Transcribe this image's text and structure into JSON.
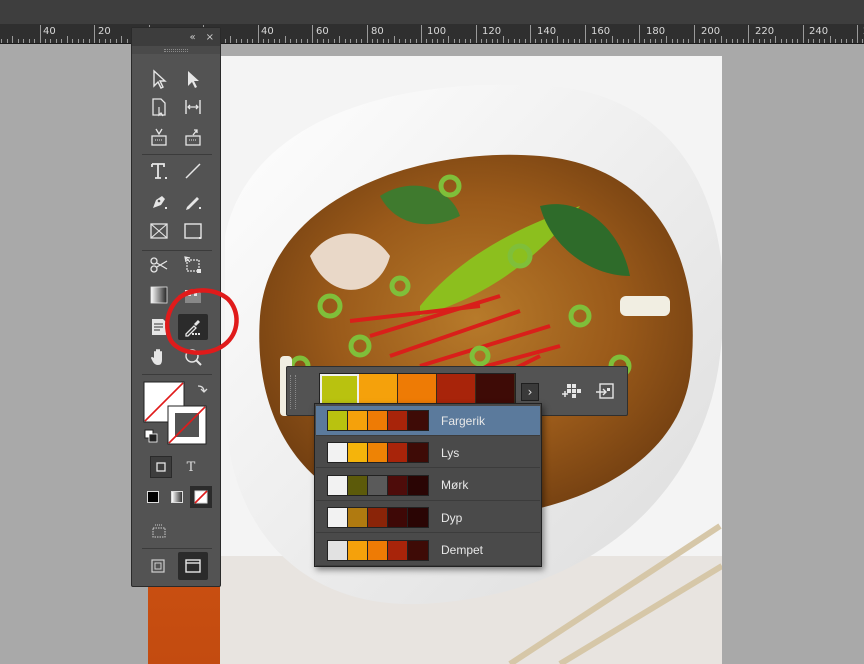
{
  "ruler": {
    "labels": [
      "40",
      "20",
      "",
      "20",
      "40",
      "60",
      "80",
      "100",
      "120",
      "140",
      "160",
      "180",
      "200",
      "220",
      "240",
      "2"
    ]
  },
  "tools_panel": {
    "collapse_label": "«",
    "close_label": "×",
    "type_mode_label": "T"
  },
  "swatch_strip": {
    "colors": [
      "#b9c20f",
      "#f5a10b",
      "#ee7b05",
      "#a8240a",
      "#3e0b06"
    ],
    "expand_label": "›"
  },
  "theme_dropdown": {
    "items": [
      {
        "label": "Fargerik",
        "colors": [
          "#b9c20f",
          "#f5a10b",
          "#ee7b05",
          "#a8240a",
          "#3e0b06"
        ],
        "highlighted": true
      },
      {
        "label": "Lys",
        "colors": [
          "#f2f2f2",
          "#f5b40b",
          "#ee8305",
          "#a8240a",
          "#3e0b06"
        ],
        "highlighted": false
      },
      {
        "label": "Mørk",
        "colors": [
          "#f2f2f2",
          "#5c5a0a",
          "#5a5a5a",
          "#4e0c0a",
          "#2a0504"
        ],
        "highlighted": false
      },
      {
        "label": "Dyp",
        "colors": [
          "#f2f2f2",
          "#b07a10",
          "#8a2408",
          "#3e0806",
          "#2a0504"
        ],
        "highlighted": false
      },
      {
        "label": "Dempet",
        "colors": [
          "#e2e2e2",
          "#f5a10b",
          "#ee7b05",
          "#a8240a",
          "#3e0b06"
        ],
        "highlighted": false
      }
    ]
  },
  "colors": {
    "annotation": "#e01b1b",
    "highlight": "#5b7a9c",
    "panel": "#535353"
  }
}
